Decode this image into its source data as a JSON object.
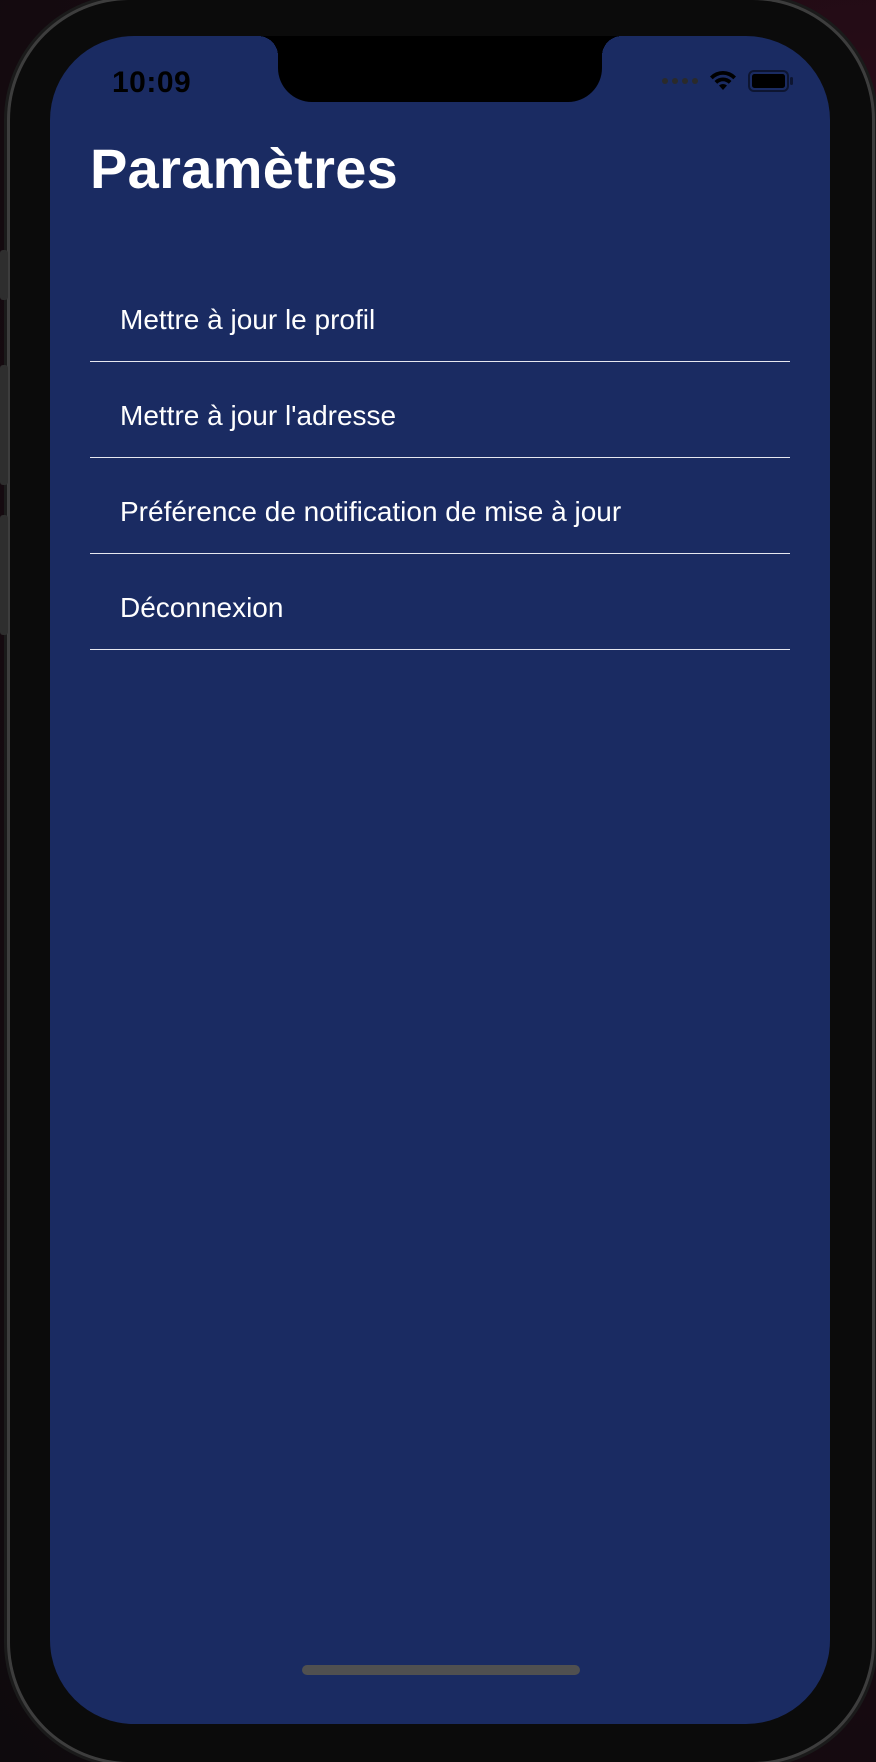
{
  "status_bar": {
    "time": "10:09",
    "wifi_icon": "wifi-icon",
    "battery_icon": "battery-icon"
  },
  "header": {
    "title": "Paramètres"
  },
  "settings": {
    "items": [
      {
        "label": "Mettre à jour le profil"
      },
      {
        "label": "Mettre à jour l'adresse"
      },
      {
        "label": "Préférence de notification de mise à jour"
      },
      {
        "label": "Déconnexion"
      }
    ]
  },
  "colors": {
    "screen_background": "#1a2b62",
    "text": "#ffffff",
    "divider": "#e6e8f0"
  }
}
